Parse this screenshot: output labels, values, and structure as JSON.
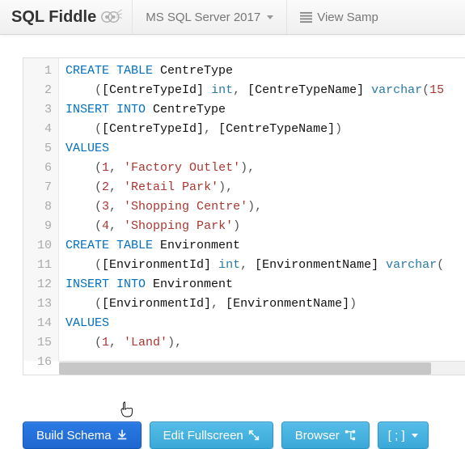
{
  "header": {
    "brand": "SQL Fiddle",
    "db_selector": "MS SQL Server 2017",
    "view_sample": "View Samp"
  },
  "editor": {
    "lines": [
      [
        {
          "t": "CREATE TABLE",
          "c": "kw"
        },
        {
          "t": " ",
          "c": "pn"
        },
        {
          "t": "CentreType",
          "c": "id"
        }
      ],
      [
        {
          "t": "    (",
          "c": "pn"
        },
        {
          "t": "[CentreTypeId]",
          "c": "id"
        },
        {
          "t": " ",
          "c": "pn"
        },
        {
          "t": "int",
          "c": "ty"
        },
        {
          "t": ", ",
          "c": "pn"
        },
        {
          "t": "[CentreTypeName]",
          "c": "id"
        },
        {
          "t": " ",
          "c": "pn"
        },
        {
          "t": "varchar",
          "c": "ty"
        },
        {
          "t": "(",
          "c": "pn"
        },
        {
          "t": "15",
          "c": "num"
        }
      ],
      [
        {
          "t": "INSERT INTO",
          "c": "kw"
        },
        {
          "t": " ",
          "c": "pn"
        },
        {
          "t": "CentreType",
          "c": "id"
        }
      ],
      [
        {
          "t": "    (",
          "c": "pn"
        },
        {
          "t": "[CentreTypeId]",
          "c": "id"
        },
        {
          "t": ", ",
          "c": "pn"
        },
        {
          "t": "[CentreTypeName]",
          "c": "id"
        },
        {
          "t": ")",
          "c": "pn"
        }
      ],
      [
        {
          "t": "VALUES",
          "c": "kw"
        }
      ],
      [
        {
          "t": "    (",
          "c": "pn"
        },
        {
          "t": "1",
          "c": "num"
        },
        {
          "t": ", ",
          "c": "pn"
        },
        {
          "t": "'Factory Outlet'",
          "c": "str"
        },
        {
          "t": "),",
          "c": "pn"
        }
      ],
      [
        {
          "t": "    (",
          "c": "pn"
        },
        {
          "t": "2",
          "c": "num"
        },
        {
          "t": ", ",
          "c": "pn"
        },
        {
          "t": "'Retail Park'",
          "c": "str"
        },
        {
          "t": "),",
          "c": "pn"
        }
      ],
      [
        {
          "t": "    (",
          "c": "pn"
        },
        {
          "t": "3",
          "c": "num"
        },
        {
          "t": ", ",
          "c": "pn"
        },
        {
          "t": "'Shopping Centre'",
          "c": "str"
        },
        {
          "t": "),",
          "c": "pn"
        }
      ],
      [
        {
          "t": "    (",
          "c": "pn"
        },
        {
          "t": "4",
          "c": "num"
        },
        {
          "t": ", ",
          "c": "pn"
        },
        {
          "t": "'Shopping Park'",
          "c": "str"
        },
        {
          "t": ")",
          "c": "pn"
        }
      ],
      [
        {
          "t": "CREATE TABLE",
          "c": "kw"
        },
        {
          "t": " ",
          "c": "pn"
        },
        {
          "t": "Environment",
          "c": "id"
        }
      ],
      [
        {
          "t": "    (",
          "c": "pn"
        },
        {
          "t": "[EnvironmentId]",
          "c": "id"
        },
        {
          "t": " ",
          "c": "pn"
        },
        {
          "t": "int",
          "c": "ty"
        },
        {
          "t": ", ",
          "c": "pn"
        },
        {
          "t": "[EnvironmentName]",
          "c": "id"
        },
        {
          "t": " ",
          "c": "pn"
        },
        {
          "t": "varchar",
          "c": "ty"
        },
        {
          "t": "(",
          "c": "pn"
        }
      ],
      [
        {
          "t": "INSERT INTO",
          "c": "kw"
        },
        {
          "t": " ",
          "c": "pn"
        },
        {
          "t": "Environment",
          "c": "id"
        }
      ],
      [
        {
          "t": "    (",
          "c": "pn"
        },
        {
          "t": "[EnvironmentId]",
          "c": "id"
        },
        {
          "t": ", ",
          "c": "pn"
        },
        {
          "t": "[EnvironmentName]",
          "c": "id"
        },
        {
          "t": ")",
          "c": "pn"
        }
      ],
      [
        {
          "t": "VALUES",
          "c": "kw"
        }
      ],
      [
        {
          "t": "    (",
          "c": "pn"
        },
        {
          "t": "1",
          "c": "num"
        },
        {
          "t": ", ",
          "c": "pn"
        },
        {
          "t": "'Land'",
          "c": "str"
        },
        {
          "t": "),",
          "c": "pn"
        }
      ]
    ],
    "line_count": 16
  },
  "buttons": {
    "build_schema": "Build Schema",
    "edit_fullscreen": "Edit Fullscreen",
    "browser": "Browser",
    "terminator": "[ ; ]"
  }
}
